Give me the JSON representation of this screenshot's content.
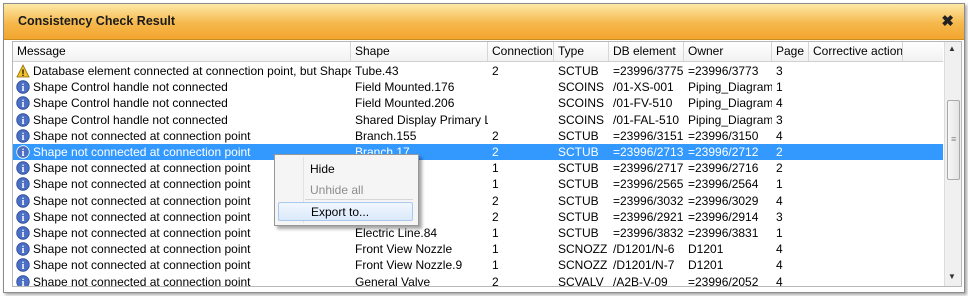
{
  "window": {
    "title": "Consistency Check Result",
    "close_glyph": "✖"
  },
  "columns": [
    "Message",
    "Shape",
    "Connection",
    "Type",
    "DB element",
    "Owner",
    "Page",
    "Corrective action"
  ],
  "rows": [
    {
      "icon": "warning-icon",
      "message": "Database element connected at connection point, but Shape is not",
      "shape": "Tube.43",
      "connection": "2",
      "type": "SCTUB",
      "db": "=23996/3775",
      "owner": "=23996/3773",
      "page": "3"
    },
    {
      "icon": "info-icon",
      "message": "Shape Control handle not connected",
      "shape": "Field Mounted.176",
      "connection": "",
      "type": "SCOINS",
      "db": "/01-XS-001",
      "owner": "Piping_Diagrams",
      "page": "1"
    },
    {
      "icon": "info-icon",
      "message": "Shape Control handle not connected",
      "shape": "Field Mounted.206",
      "connection": "",
      "type": "SCOINS",
      "db": "/01-FV-510",
      "owner": "Piping_Diagrams",
      "page": "4"
    },
    {
      "icon": "info-icon",
      "message": "Shape Control handle not connected",
      "shape": "Shared Display Primary L...",
      "connection": "",
      "type": "SCOINS",
      "db": "/01-FAL-510",
      "owner": "Piping_Diagrams",
      "page": "3"
    },
    {
      "icon": "info-icon",
      "message": "Shape not connected at connection point",
      "shape": "Branch.155",
      "connection": "2",
      "type": "SCTUB",
      "db": "=23996/3151",
      "owner": "=23996/3150",
      "page": "4"
    },
    {
      "icon": "info-icon",
      "message": "Shape not connected at connection point",
      "shape": "Branch.17",
      "connection": "2",
      "type": "SCTUB",
      "db": "=23996/2713",
      "owner": "=23996/2712",
      "page": "2",
      "selected": true
    },
    {
      "icon": "info-icon",
      "message": "Shape not connected at connection point",
      "shape": "",
      "connection": "1",
      "type": "SCTUB",
      "db": "=23996/2717",
      "owner": "=23996/2716",
      "page": "2"
    },
    {
      "icon": "info-icon",
      "message": "Shape not connected at connection point",
      "shape": "",
      "connection": "1",
      "type": "SCTUB",
      "db": "=23996/2565",
      "owner": "=23996/2564",
      "page": "1"
    },
    {
      "icon": "info-icon",
      "message": "Shape not connected at connection point",
      "shape": "",
      "connection": "2",
      "type": "SCTUB",
      "db": "=23996/3032",
      "owner": "=23996/3029",
      "page": "4"
    },
    {
      "icon": "info-icon",
      "message": "Shape not connected at connection point",
      "shape": "",
      "connection": "2",
      "type": "SCTUB",
      "db": "=23996/2921",
      "owner": "=23996/2914",
      "page": "3"
    },
    {
      "icon": "info-icon",
      "message": "Shape not connected at connection point",
      "shape": "Electric Line.84",
      "connection": "1",
      "type": "SCTUB",
      "db": "=23996/3832",
      "owner": "=23996/3831",
      "page": "1"
    },
    {
      "icon": "info-icon",
      "message": "Shape not connected at connection point",
      "shape": "Front View Nozzle",
      "connection": "1",
      "type": "SCNOZZ",
      "db": "/D1201/N-6",
      "owner": "D1201",
      "page": "4"
    },
    {
      "icon": "info-icon",
      "message": "Shape not connected at connection point",
      "shape": "Front View Nozzle.9",
      "connection": "1",
      "type": "SCNOZZ",
      "db": "/D1201/N-7",
      "owner": "D1201",
      "page": "4"
    },
    {
      "icon": "info-icon",
      "message": "Shape not connected at connection point",
      "shape": "General Valve",
      "connection": "2",
      "type": "SCVALV",
      "db": "/A2B-V-09",
      "owner": "=23996/2052",
      "page": "4"
    }
  ],
  "context_menu": {
    "items": [
      {
        "label": "Hide",
        "enabled": true
      },
      {
        "label": "Unhide all",
        "enabled": false
      },
      {
        "label": "Export to...",
        "enabled": true,
        "highlighted": true
      }
    ]
  },
  "colors": {
    "selection": "#3399ff",
    "titlebar": "#f6b84c",
    "info_icon": "#4a6fc4",
    "warning_icon": "#f2c12e"
  }
}
